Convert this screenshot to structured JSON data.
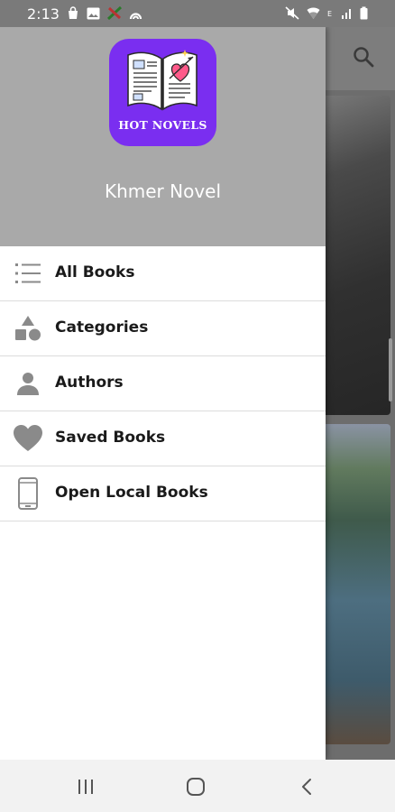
{
  "status_bar": {
    "time": "2:13",
    "left_icons": [
      "bag-icon",
      "image-icon",
      "app-icon",
      "signal-arc-icon"
    ],
    "right_icons": [
      "mute-icon",
      "wifi-icon",
      "data-e-icon",
      "signal-icon",
      "battery-icon"
    ]
  },
  "drawer": {
    "logo_text": "HOT NOVELS",
    "app_name": "Khmer Novel",
    "items": [
      {
        "label": "All Books",
        "icon": "list-icon"
      },
      {
        "label": "Categories",
        "icon": "shapes-icon"
      },
      {
        "label": "Authors",
        "icon": "person-icon"
      },
      {
        "label": "Saved Books",
        "icon": "heart-icon"
      },
      {
        "label": "Open Local Books",
        "icon": "phone-icon"
      }
    ]
  },
  "background_app": {
    "toolbar_icon": "search-icon"
  },
  "nav_bar": {
    "buttons": [
      "recents-icon",
      "home-icon",
      "back-icon"
    ]
  },
  "colors": {
    "logo_bg": "#7a2ef0",
    "header_bg": "#a9a9a9",
    "icon_gray": "#8a8a8a"
  }
}
